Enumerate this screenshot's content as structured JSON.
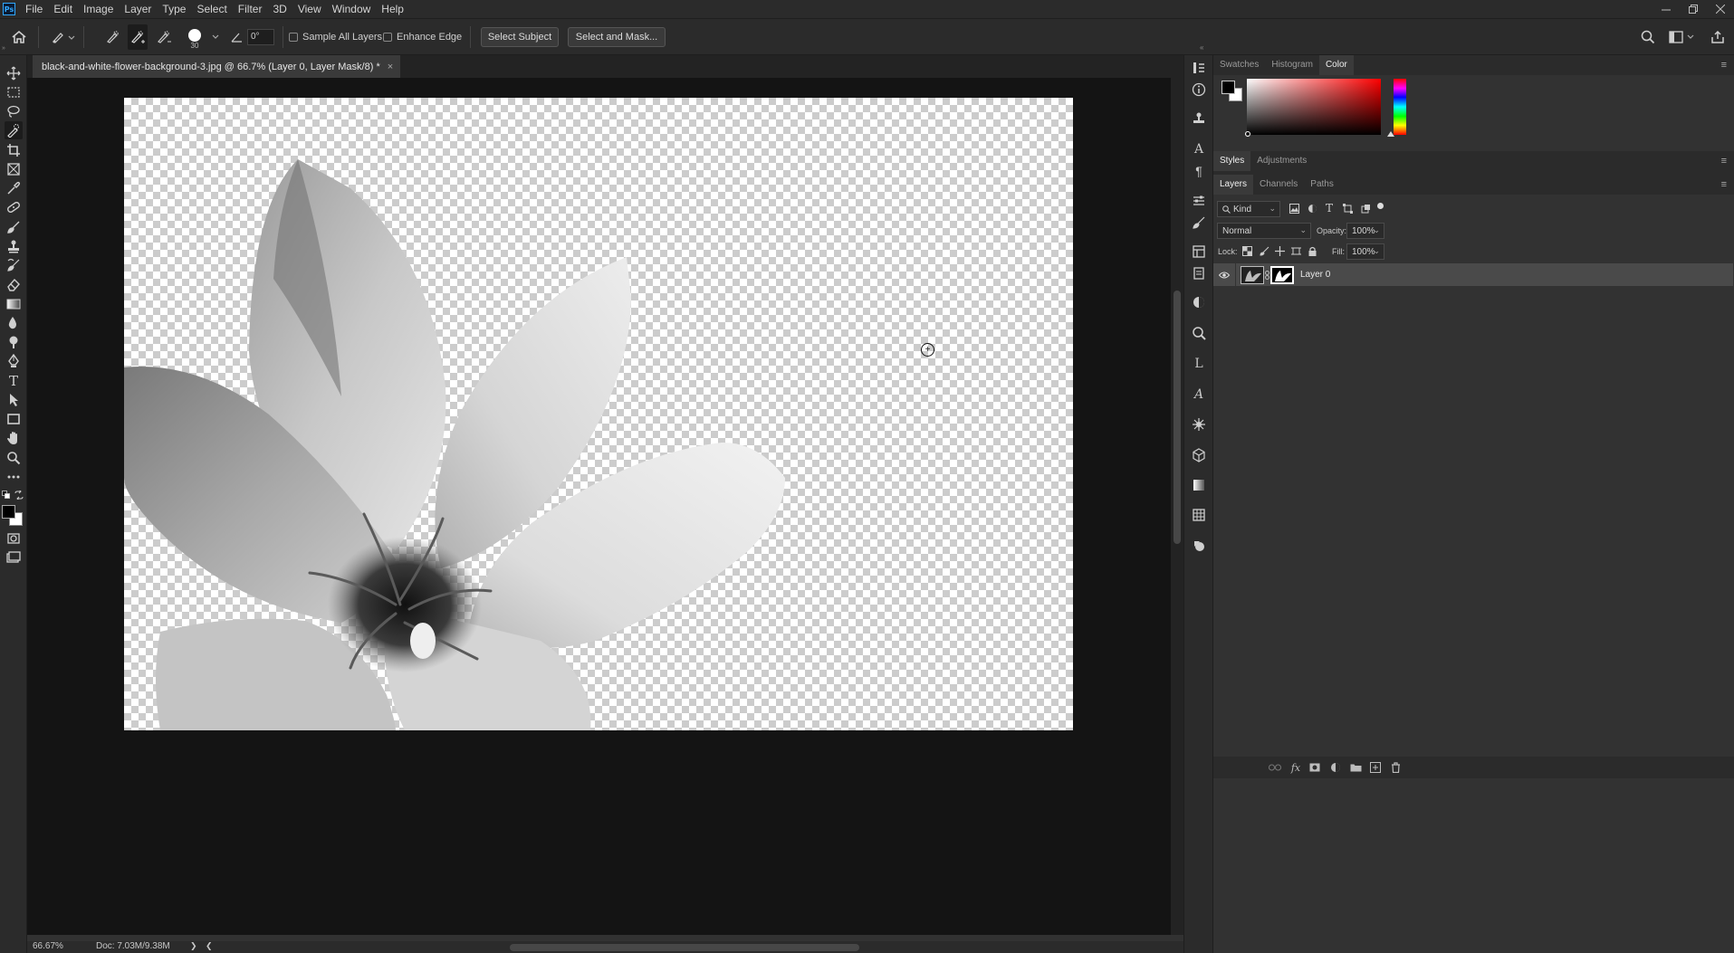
{
  "app": {
    "logo_text": "Ps",
    "menu": [
      "File",
      "Edit",
      "Image",
      "Layer",
      "Type",
      "Select",
      "Filter",
      "3D",
      "View",
      "Window",
      "Help"
    ],
    "window_controls": [
      "minimize-icon",
      "restore-icon",
      "close-icon"
    ]
  },
  "options_bar": {
    "brush_size": "30",
    "angle_value": "0°",
    "sample_all_layers": {
      "label": "Sample All Layers",
      "checked": false
    },
    "enhance_edge": {
      "label": "Enhance Edge",
      "checked": false
    },
    "select_subject_label": "Select Subject",
    "select_and_mask_label": "Select and Mask..."
  },
  "document": {
    "tab_title": "black-and-white-flower-background-3.jpg @ 66.7% (Layer 0, Layer Mask/8) *",
    "tab_close": "×",
    "content": "grayscale lily flower with transparent background (checkerboard)"
  },
  "status_bar": {
    "zoom": "66.67%",
    "doc_info": "Doc: 7.03M/9.38M",
    "arrow_right": "❯",
    "arrow_left": "❮"
  },
  "color_panel": {
    "tabs": [
      "Swatches",
      "Histogram",
      "Color"
    ],
    "active_tab": "Color",
    "foreground": "#000000",
    "background": "#ffffff",
    "hue_color": "#ff0000"
  },
  "styles_panel": {
    "tabs": [
      "Styles",
      "Adjustments"
    ],
    "active_tab": "Styles"
  },
  "layers_panel": {
    "tabs": [
      "Layers",
      "Channels",
      "Paths"
    ],
    "active_tab": "Layers",
    "filter_kind": "Kind",
    "blend_mode": "Normal",
    "opacity_label": "Opacity:",
    "opacity_value": "100%",
    "lock_label": "Lock:",
    "fill_label": "Fill:",
    "fill_value": "100%",
    "layers": [
      {
        "name": "Layer 0",
        "visible": true,
        "has_mask": true,
        "selected": true
      }
    ]
  },
  "toolbar": {
    "tools": [
      "move-tool",
      "marquee-tool",
      "lasso-tool",
      "quick-selection-tool",
      "crop-tool",
      "frame-tool",
      "eyedropper-tool",
      "healing-brush-tool",
      "brush-tool",
      "clone-stamp-tool",
      "history-brush-tool",
      "eraser-tool",
      "gradient-tool",
      "blur-tool",
      "dodge-tool",
      "pen-tool",
      "type-tool",
      "path-selection-tool",
      "rectangle-tool",
      "hand-tool",
      "zoom-tool",
      "more-tools"
    ],
    "active_tool": "quick-selection-tool"
  }
}
